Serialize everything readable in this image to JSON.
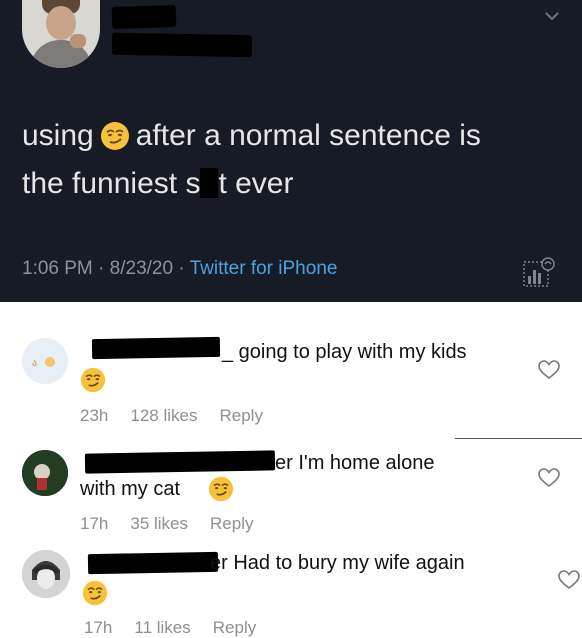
{
  "tweet": {
    "text_line1_start": "using",
    "text_line1_end": "after a normal sentence is",
    "text_line2_start": "the funniest s",
    "text_line2_end": "t ever",
    "time": "1:06 PM",
    "date": "8/23/20",
    "separator": "·",
    "source": "Twitter for iPhone",
    "emoji": "smirk-emoji"
  },
  "comments": [
    {
      "text": "_ going to play with my kids",
      "time": "23h",
      "likes": "128 likes",
      "reply": "Reply"
    },
    {
      "text_line1": "er I'm home alone",
      "text_line2": "with my cat",
      "time": "17h",
      "likes": "35 likes",
      "reply": "Reply"
    },
    {
      "text": "er Had to bury my wife again",
      "time": "17h",
      "likes": "11 likes",
      "reply": "Reply"
    }
  ],
  "colors": {
    "tweet_bg": "#161b25",
    "link": "#4aa3df",
    "emoji": "#f7c23a"
  }
}
